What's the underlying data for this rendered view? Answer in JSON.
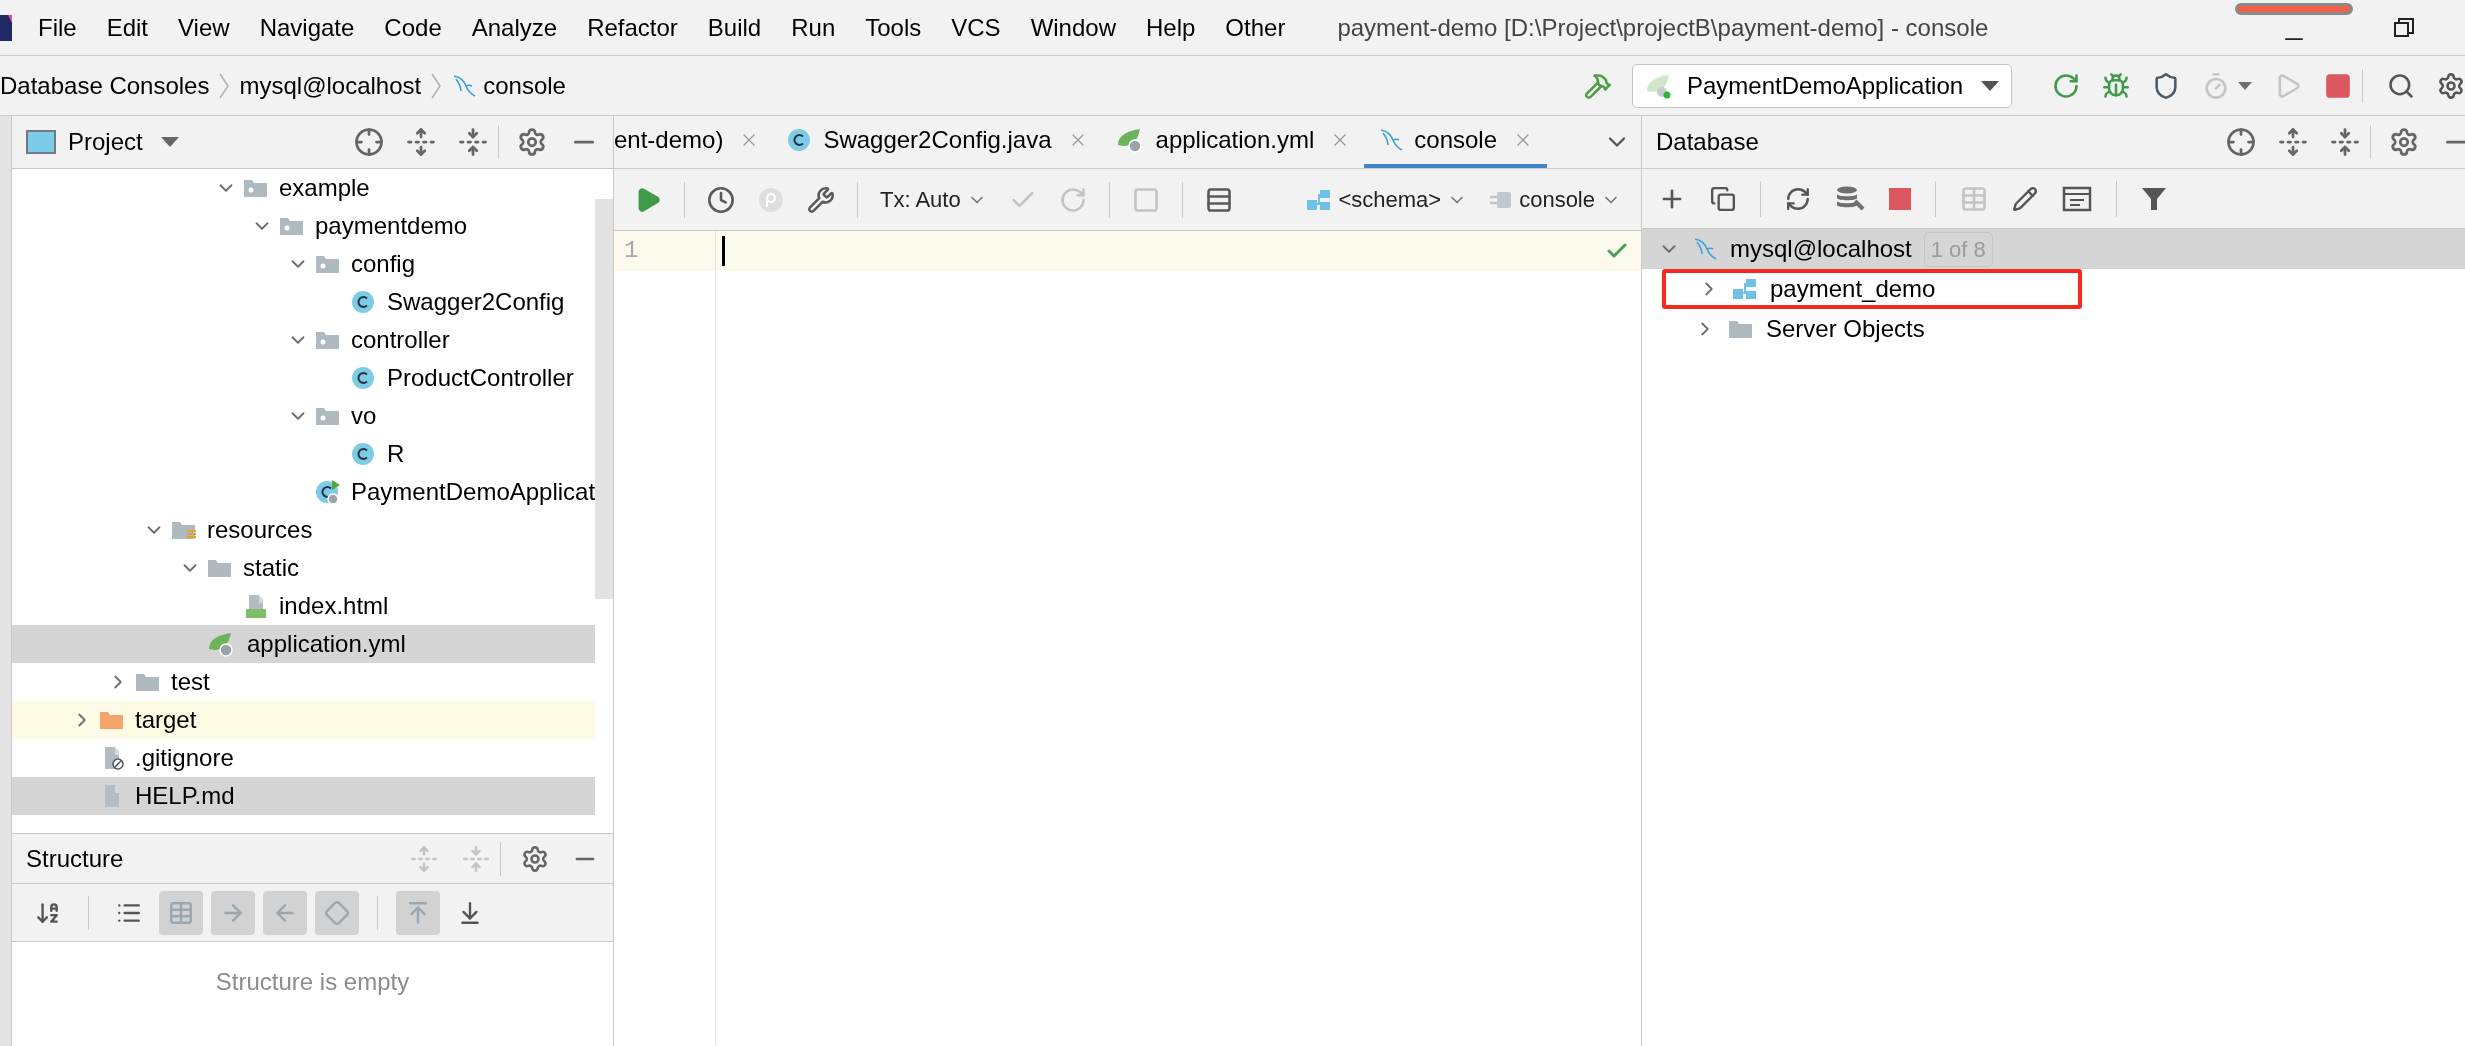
{
  "menu_bar": {
    "items": [
      "File",
      "Edit",
      "View",
      "Navigate",
      "Code",
      "Analyze",
      "Refactor",
      "Build",
      "Run",
      "Tools",
      "VCS",
      "Window",
      "Help",
      "Other"
    ]
  },
  "window": {
    "title": "payment-demo [D:\\Project\\projectB\\payment-demo] - console"
  },
  "breadcrumbs": [
    {
      "label": "Database Consoles",
      "kind": "plain"
    },
    {
      "label": "mysql@localhost",
      "kind": "plain"
    },
    {
      "label": "console",
      "kind": "mysql"
    }
  ],
  "run_toolbar": {
    "configuration": "PaymentDemoApplication",
    "buttons": [
      {
        "kind": "rerun",
        "disabled": false
      },
      {
        "kind": "debug",
        "disabled": false
      },
      {
        "kind": "coverage",
        "disabled": false
      },
      {
        "kind": "profile",
        "disabled": true
      },
      {
        "kind": "run",
        "disabled": true
      },
      {
        "kind": "stop",
        "disabled": false
      }
    ]
  },
  "project_panel": {
    "title": "Project",
    "tree": [
      {
        "children": [
          {
            "children": [
              {
                "children": [
                  {
                    "children": [
                      {
                        "label": "example",
                        "kind": "package",
                        "expanded": true,
                        "selected": false,
                        "children": [
                          {
                            "label": "paymentdemo",
                            "kind": "package",
                            "expanded": true,
                            "selected": false,
                            "children": [
                              {
                                "label": "config",
                                "kind": "package",
                                "expanded": true,
                                "selected": false,
                                "children": [
                                  {
                                    "label": "Swagger2Config",
                                    "kind": "class",
                                    "selected": false
                                  }
                                ]
                              },
                              {
                                "label": "controller",
                                "kind": "package",
                                "expanded": true,
                                "selected": false,
                                "children": [
                                  {
                                    "label": "ProductController",
                                    "kind": "class",
                                    "selected": false
                                  }
                                ]
                              },
                              {
                                "label": "vo",
                                "kind": "package",
                                "expanded": true,
                                "selected": false,
                                "children": [
                                  {
                                    "label": "R",
                                    "kind": "class",
                                    "selected": false
                                  }
                                ]
                              },
                              {
                                "label": "PaymentDemoApplicat",
                                "kind": "spring-class",
                                "selected": false
                              }
                            ]
                          }
                        ]
                      }
                    ]
                  }
                ]
              },
              {
                "label": "resources",
                "kind": "resources-folder",
                "expanded": true,
                "selected": false,
                "children": [
                  {
                    "label": "static",
                    "kind": "folder",
                    "expanded": true,
                    "selected": false,
                    "children": [
                      {
                        "label": "index.html",
                        "kind": "html",
                        "selected": false
                      }
                    ]
                  },
                  {
                    "label": "application.yml",
                    "kind": "yaml",
                    "selected": true
                  }
                ]
              }
            ]
          },
          {
            "label": "test",
            "kind": "folder",
            "expanded": false,
            "selected": false
          }
        ]
      },
      {
        "label": "target",
        "kind": "excluded-folder",
        "expanded": false,
        "selected": false
      },
      {
        "label": ".gitignore",
        "kind": "gitignore",
        "selected": false
      },
      {
        "label": "HELP.md",
        "kind": "markdown",
        "selected": true
      }
    ]
  },
  "structure_panel": {
    "title": "Structure",
    "toolbar": [
      {
        "kind": "sort",
        "on": false
      },
      {
        "kind": "expand",
        "on": false
      },
      {
        "kind": "fields",
        "on": true
      },
      {
        "kind": "inherited",
        "on": true
      },
      {
        "kind": "implemented",
        "on": true
      },
      {
        "kind": "non-public",
        "on": true
      },
      {
        "kind": "autoscroll-from",
        "on": true
      },
      {
        "kind": "autoscroll-to",
        "on": false
      }
    ],
    "empty_text": "Structure is empty"
  },
  "editor": {
    "tabs": [
      {
        "label": "ent-demo)",
        "kind": "cut",
        "selected": false
      },
      {
        "label": "Swagger2Config.java",
        "kind": "class",
        "selected": false
      },
      {
        "label": "application.yml",
        "kind": "yaml",
        "selected": false
      },
      {
        "label": "console",
        "kind": "mysql",
        "selected": true
      }
    ],
    "toolbar": [
      {
        "kind": "execute",
        "disabled": false
      },
      {
        "kind": "history",
        "disabled": false
      },
      {
        "kind": "parameters",
        "disabled": true
      },
      {
        "kind": "settings",
        "disabled": false
      },
      {
        "kind": "tx",
        "label": "Tx: Auto",
        "disabled": false
      },
      {
        "kind": "commit",
        "disabled": true
      },
      {
        "kind": "rollback",
        "disabled": true
      },
      {
        "kind": "cancel",
        "disabled": true
      },
      {
        "kind": "output",
        "disabled": false
      },
      {
        "kind": "schema",
        "label": "<schema>",
        "disabled": false
      },
      {
        "kind": "session",
        "label": "console",
        "disabled": false
      }
    ],
    "line_numbers": [
      "1"
    ]
  },
  "database_panel": {
    "title": "Database",
    "tree": [
      {
        "label": "mysql@localhost",
        "badge": "1 of 8",
        "kind": "mysql",
        "expanded": true,
        "selected": true,
        "outlined": false,
        "children": [
          {
            "label": "payment_demo",
            "kind": "schema",
            "expanded": false,
            "selected": false,
            "outlined": true
          },
          {
            "label": "Server Objects",
            "kind": "folder",
            "expanded": false,
            "selected": false,
            "outlined": false
          }
        ]
      }
    ]
  }
}
